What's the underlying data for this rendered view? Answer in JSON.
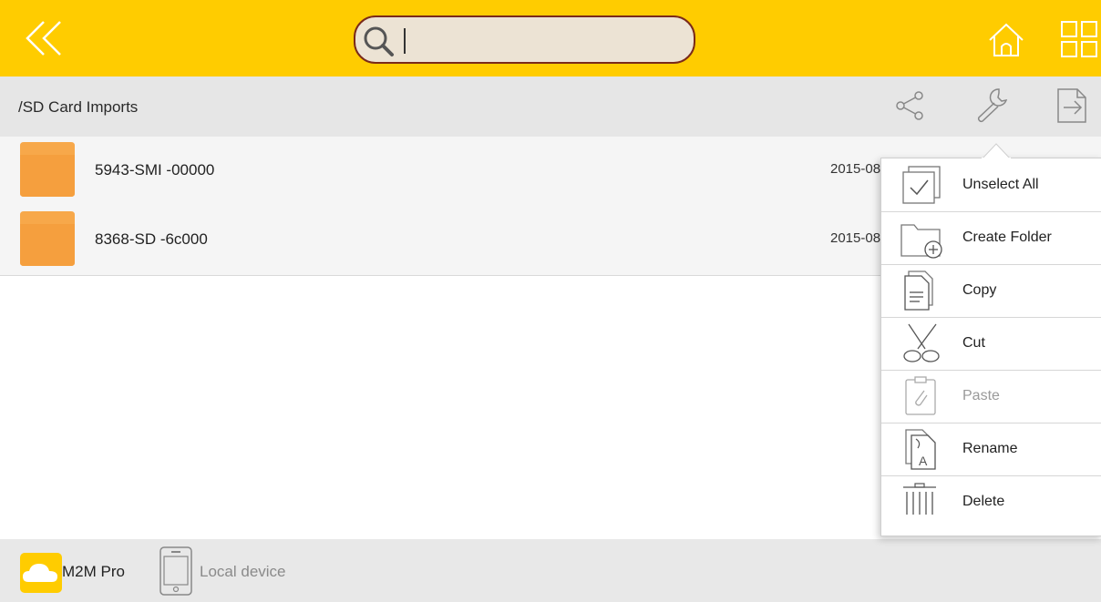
{
  "header": {
    "search": {
      "value": "",
      "placeholder": ""
    },
    "colors": {
      "background": "#ffcc00",
      "search_border": "#7a2a1a",
      "search_fill": "#ece3d4"
    },
    "icons": [
      "double-chevron-left-icon",
      "search-icon",
      "home-icon",
      "grid-icon"
    ]
  },
  "toolbar": {
    "path": "/SD Card Imports",
    "icons": [
      "share-icon",
      "wrench-icon",
      "export-icon"
    ]
  },
  "files": [
    {
      "name": "5943-SMI -00000",
      "date": "2015-08"
    },
    {
      "name": "8368-SD -6c000",
      "date": "2015-08"
    }
  ],
  "context_menu": {
    "items": [
      {
        "label": "Unselect All",
        "icon": "checkbox-icon",
        "enabled": true
      },
      {
        "label": "Create Folder",
        "icon": "folder-plus-icon",
        "enabled": true
      },
      {
        "label": "Copy",
        "icon": "copy-icon",
        "enabled": true
      },
      {
        "label": "Cut",
        "icon": "scissors-icon",
        "enabled": true
      },
      {
        "label": "Paste",
        "icon": "clipboard-icon",
        "enabled": false
      },
      {
        "label": "Rename",
        "icon": "rename-icon",
        "enabled": true
      },
      {
        "label": "Delete",
        "icon": "trash-icon",
        "enabled": true
      }
    ]
  },
  "footer": {
    "sources": [
      {
        "label": "M2M Pro",
        "icon": "cloud-icon",
        "active": true
      },
      {
        "label": "Local device",
        "icon": "phone-icon",
        "active": false
      }
    ]
  },
  "colors": {
    "accent": "#ffcc00",
    "folder": "#f7a84a",
    "panel": "#e6e6e6"
  }
}
